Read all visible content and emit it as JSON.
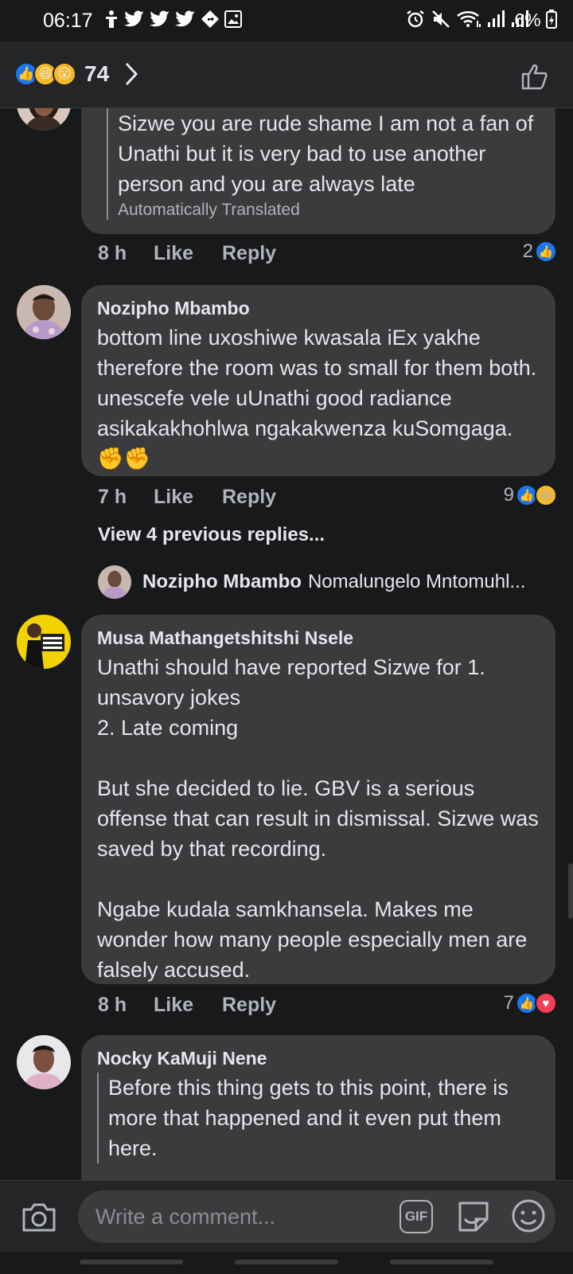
{
  "status_bar": {
    "time": "06:17",
    "battery": "6%"
  },
  "header": {
    "reaction_count": "74",
    "reaction_icons": [
      "like-icon",
      "haha-icon",
      "wow-icon"
    ]
  },
  "comments": [
    {
      "name": "",
      "text": "Sizwe you are rude shame I am not a fan of Unathi but it is very bad to use another person and you are always late",
      "translated_label": "Automatically Translated",
      "time": "8 h",
      "like_label": "Like",
      "reply_label": "Reply",
      "reaction_count": "2"
    },
    {
      "name": "Nozipho Mbambo",
      "text": "bottom line uxoshiwe kwasala iEx yakhe therefore the room was to small for them both. unescefe vele uUnathi good radiance asikakakhohlwa ngakakwenza kuSomgaga. ✊✊",
      "time": "7 h",
      "like_label": "Like",
      "reply_label": "Reply",
      "reaction_count": "9",
      "view_previous": "View 4 previous replies...",
      "latest_reply": {
        "name": "Nozipho Mbambo",
        "text": "Nomalungelo Mntomuhl..."
      }
    },
    {
      "name": "Musa Mathangetshitshi Nsele",
      "text": "Unathi should have reported Sizwe for 1. unsavory jokes\n2. Late coming\n\nBut she decided to lie. GBV is a serious offense that can result in dismissal. Sizwe was saved by that recording.\n\nNgabe kudala samkhansela. Makes me wonder how many people especially men are falsely accused.",
      "time": "8 h",
      "like_label": "Like",
      "reply_label": "Reply",
      "reaction_count": "7"
    },
    {
      "name": "Nocky KaMuji Nene",
      "text": "Before this thing gets to this point, there is more that happened and it even put them here."
    }
  ],
  "composer": {
    "placeholder": "Write a comment...",
    "gif_label": "GIF"
  },
  "colors": {
    "background": "#18191a",
    "bubble": "#3a3b3c",
    "like_blue": "#1877f2",
    "love_red": "#f33e58",
    "haha_yellow": "#f7b928"
  }
}
